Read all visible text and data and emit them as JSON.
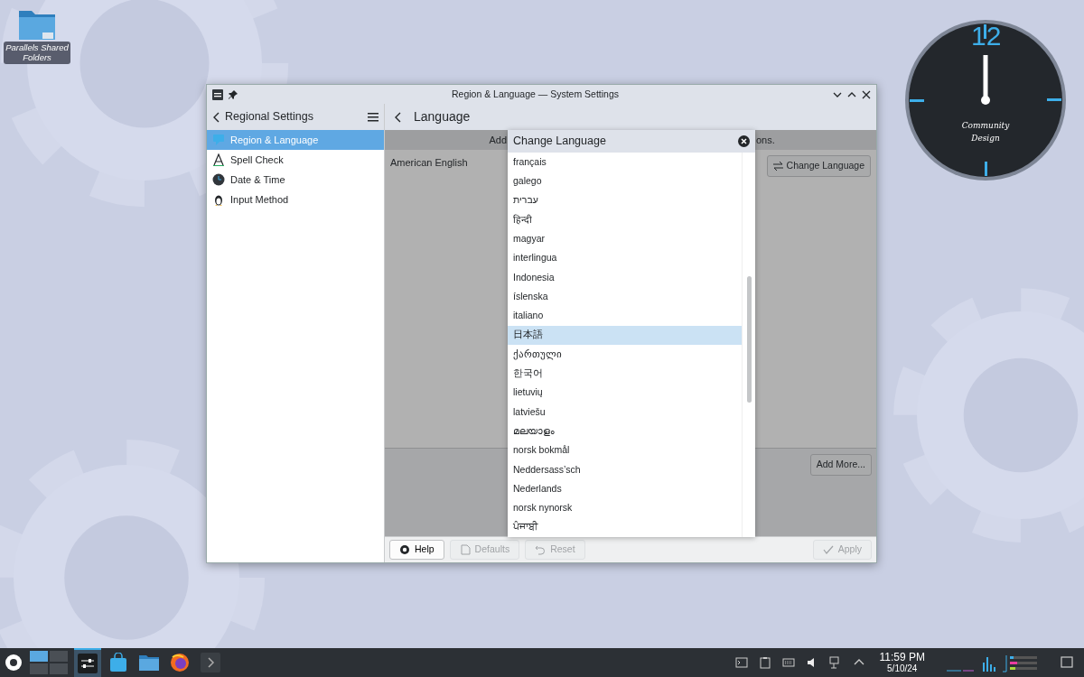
{
  "desktop_icons": [
    {
      "label": "Parallels Shared Folders"
    }
  ],
  "clock_widget": {
    "hour_label": "12",
    "caption": "Community Design"
  },
  "window": {
    "title": "Region & Language — System Settings",
    "sidebar": {
      "title": "Regional Settings",
      "items": [
        {
          "label": "Region & Language",
          "selected": true
        },
        {
          "label": "Spell Check",
          "selected": false
        },
        {
          "label": "Date & Time",
          "selected": false
        },
        {
          "label": "Input Method",
          "selected": false
        }
      ]
    },
    "page": {
      "title": "Language",
      "banner_fragments": [
        "Add",
        "ons."
      ],
      "languages": [
        "American English"
      ],
      "change_button": "Change Language",
      "add_more_button": "Add More..."
    },
    "dialog": {
      "title": "Change Language",
      "items": [
        {
          "label": "français",
          "selected": false
        },
        {
          "label": "galego",
          "selected": false
        },
        {
          "label": "עברית",
          "selected": false
        },
        {
          "label": "हिन्दी",
          "selected": false
        },
        {
          "label": "magyar",
          "selected": false
        },
        {
          "label": "interlingua",
          "selected": false
        },
        {
          "label": "Indonesia",
          "selected": false
        },
        {
          "label": "íslenska",
          "selected": false
        },
        {
          "label": "italiano",
          "selected": false
        },
        {
          "label": "日本語",
          "selected": true
        },
        {
          "label": "ქართული",
          "selected": false
        },
        {
          "label": "한국어",
          "selected": false
        },
        {
          "label": "lietuvių",
          "selected": false
        },
        {
          "label": "latviešu",
          "selected": false
        },
        {
          "label": "മലയാളം",
          "selected": false
        },
        {
          "label": "norsk bokmål",
          "selected": false
        },
        {
          "label": "Neddersass’sch",
          "selected": false
        },
        {
          "label": "Nederlands",
          "selected": false
        },
        {
          "label": "norsk nynorsk",
          "selected": false
        },
        {
          "label": "ਪੰਜਾਬੀ",
          "selected": false
        }
      ]
    },
    "footer_buttons": [
      {
        "label": "Help",
        "disabled": false
      },
      {
        "label": "Defaults",
        "disabled": true
      },
      {
        "label": "Reset",
        "disabled": true
      },
      {
        "label": "Apply",
        "disabled": true
      }
    ]
  },
  "taskbar": {
    "tasks": [
      {
        "kind": "pager",
        "active": false
      },
      {
        "kind": "settings",
        "active": true
      },
      {
        "kind": "store",
        "active": false
      },
      {
        "kind": "files",
        "active": false
      },
      {
        "kind": "browser",
        "active": false
      },
      {
        "kind": "terminal",
        "active": false
      }
    ],
    "time": "11:59 PM",
    "date": "5/10/24"
  }
}
